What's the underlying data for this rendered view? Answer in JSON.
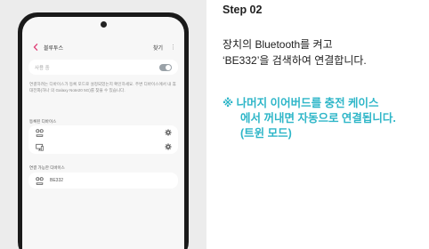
{
  "phone": {
    "header": {
      "title": "블루투스",
      "search_label": "찾기",
      "more_glyph": "⋮"
    },
    "toggle": {
      "label": "사용 중",
      "state": "on"
    },
    "description": "연결하려는 디바이스가 등록 모드로 설정되었는지 확인하세요. 주변 디바이스에서 내 휴대전화(하나 의 Galaxy Note20 5G)를 찾을 수 있습니다.",
    "registered_section": {
      "label": "등록된 디바이스",
      "devices": [
        {
          "name": "",
          "icon": "earbuds-icon"
        },
        {
          "name": "",
          "icon": "computer-icon"
        }
      ]
    },
    "available_section": {
      "label": "연결 가능한 디바이스",
      "devices": [
        {
          "name": "BE332",
          "icon": "earbuds-icon"
        }
      ]
    }
  },
  "step": {
    "title": "Step 02",
    "instruction_lines": [
      "장치의 Bluetooth를 켜고",
      "‘BE332’을 검색하여 연결합니다."
    ],
    "note_lines": [
      "※ 나머지 이어버드를 충전 케이스",
      "에서 꺼내면 자동으로 연결됩니다.",
      "(트윈 모드)"
    ]
  },
  "colors": {
    "accent": "#2eb6c8",
    "text": "#212121",
    "panel_bg": "#ececec"
  }
}
